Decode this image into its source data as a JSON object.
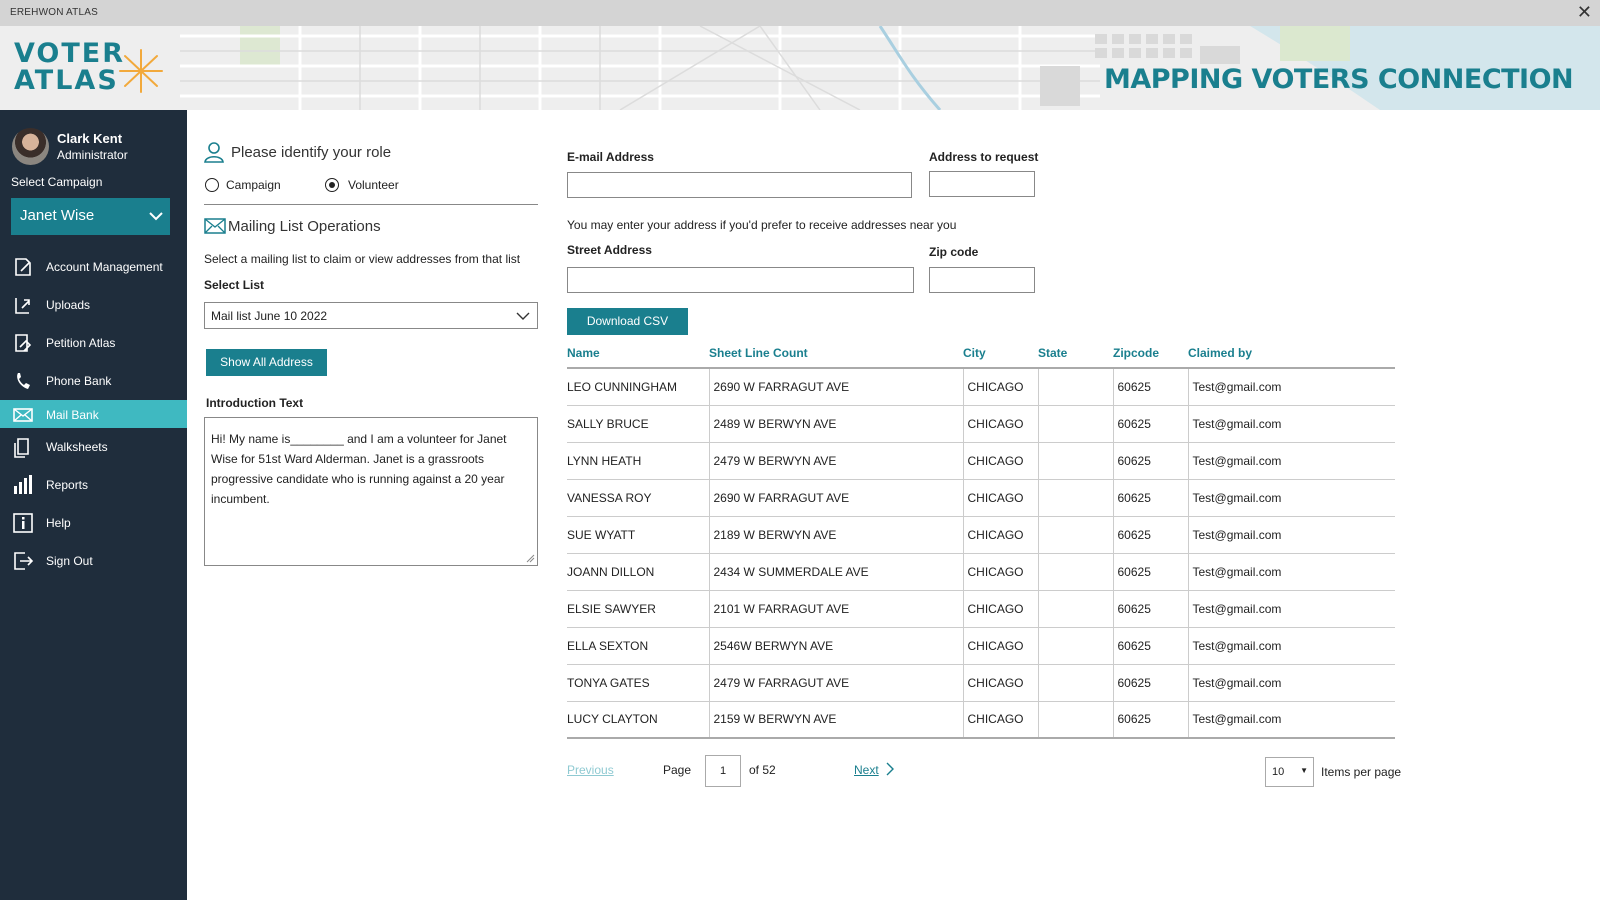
{
  "window": {
    "title": "EREHWON ATLAS",
    "close_symbol": "✕"
  },
  "banner": {
    "logo_line1": "VOTER",
    "logo_line2": "ATLAS",
    "headline": "MAPPING VOTERS CONNECTION",
    "colors": {
      "brand": "#1a7f8e",
      "star": "#f2a93b"
    }
  },
  "sidebar": {
    "user_name": "Clark Kent",
    "user_role": "Administrator",
    "select_campaign_label": "Select Campaign",
    "campaign_value": "Janet Wise",
    "items": [
      {
        "label": "Account Management",
        "icon": "edit-document-icon"
      },
      {
        "label": "Uploads",
        "icon": "upload-icon"
      },
      {
        "label": "Petition Atlas",
        "icon": "petition-icon"
      },
      {
        "label": "Phone Bank",
        "icon": "phone-icon"
      },
      {
        "label": "Mail Bank",
        "icon": "mail-icon",
        "active": true
      },
      {
        "label": "Walksheets",
        "icon": "walksheet-icon"
      },
      {
        "label": "Reports",
        "icon": "bar-chart-icon"
      },
      {
        "label": "Help",
        "icon": "info-icon"
      },
      {
        "label": "Sign Out",
        "icon": "sign-out-icon"
      }
    ]
  },
  "role": {
    "heading": "Please identify your role",
    "options": [
      "Campaign",
      "Volunteer"
    ],
    "selected": "Volunteer"
  },
  "mailing": {
    "heading": "Mailing List Operations",
    "description": "Select a mailing list to claim or view addresses from that list",
    "select_label": "Select List",
    "select_value": "Mail list June 10 2022",
    "show_all_button": "Show All Address",
    "intro_label": "Introduction Text",
    "intro_text": "Hi! My name is________ and I am a volunteer for Janet Wise  for 51st Ward Alderman. Janet is a grassroots progressive candidate who is running against a 20 year incumbent."
  },
  "form": {
    "email_label": "E-mail Address",
    "email_value": "",
    "address_to_request_label": "Address to request",
    "address_to_request_value": "",
    "hint": "You may enter your address if you'd prefer to receive addresses near you",
    "street_label": "Street Address",
    "street_value": "",
    "zip_label": "Zip code",
    "zip_value": "",
    "download_button": "Download CSV"
  },
  "table": {
    "columns": [
      "Name",
      "Sheet Line Count",
      "City",
      "State",
      "Zipcode",
      "Claimed by"
    ],
    "rows": [
      [
        "LEO CUNNINGHAM",
        "2690 W FARRAGUT AVE",
        "CHICAGO",
        "",
        "60625",
        "Test@gmail.com"
      ],
      [
        "SALLY BRUCE",
        "2489 W BERWYN AVE",
        "CHICAGO",
        "",
        "60625",
        "Test@gmail.com"
      ],
      [
        "LYNN HEATH",
        "2479 W BERWYN AVE",
        "CHICAGO",
        "",
        "60625",
        "Test@gmail.com"
      ],
      [
        "VANESSA ROY",
        "2690 W FARRAGUT AVE",
        "CHICAGO",
        "",
        "60625",
        "Test@gmail.com"
      ],
      [
        "SUE WYATT",
        "2189 W BERWYN AVE",
        "CHICAGO",
        "",
        "60625",
        "Test@gmail.com"
      ],
      [
        "JOANN DILLON",
        "2434 W SUMMERDALE AVE",
        "CHICAGO",
        "",
        "60625",
        "Test@gmail.com"
      ],
      [
        "ELSIE SAWYER",
        "2101 W FARRAGUT AVE",
        "CHICAGO",
        "",
        "60625",
        "Test@gmail.com"
      ],
      [
        "ELLA SEXTON",
        "2546W BERWYN AVE",
        "CHICAGO",
        "",
        "60625",
        "Test@gmail.com"
      ],
      [
        "TONYA GATES",
        "2479 W FARRAGUT AVE",
        "CHICAGO",
        "",
        "60625",
        "Test@gmail.com"
      ],
      [
        "LUCY CLAYTON",
        "2159 W BERWYN AVE",
        "CHICAGO",
        "",
        "60625",
        "Test@gmail.com"
      ]
    ]
  },
  "pager": {
    "previous": "Previous",
    "page_label": "Page",
    "page_value": "1",
    "of_label": "of 52",
    "next": "Next",
    "items_per_page_value": "10",
    "items_per_page_label": "Items per page"
  }
}
